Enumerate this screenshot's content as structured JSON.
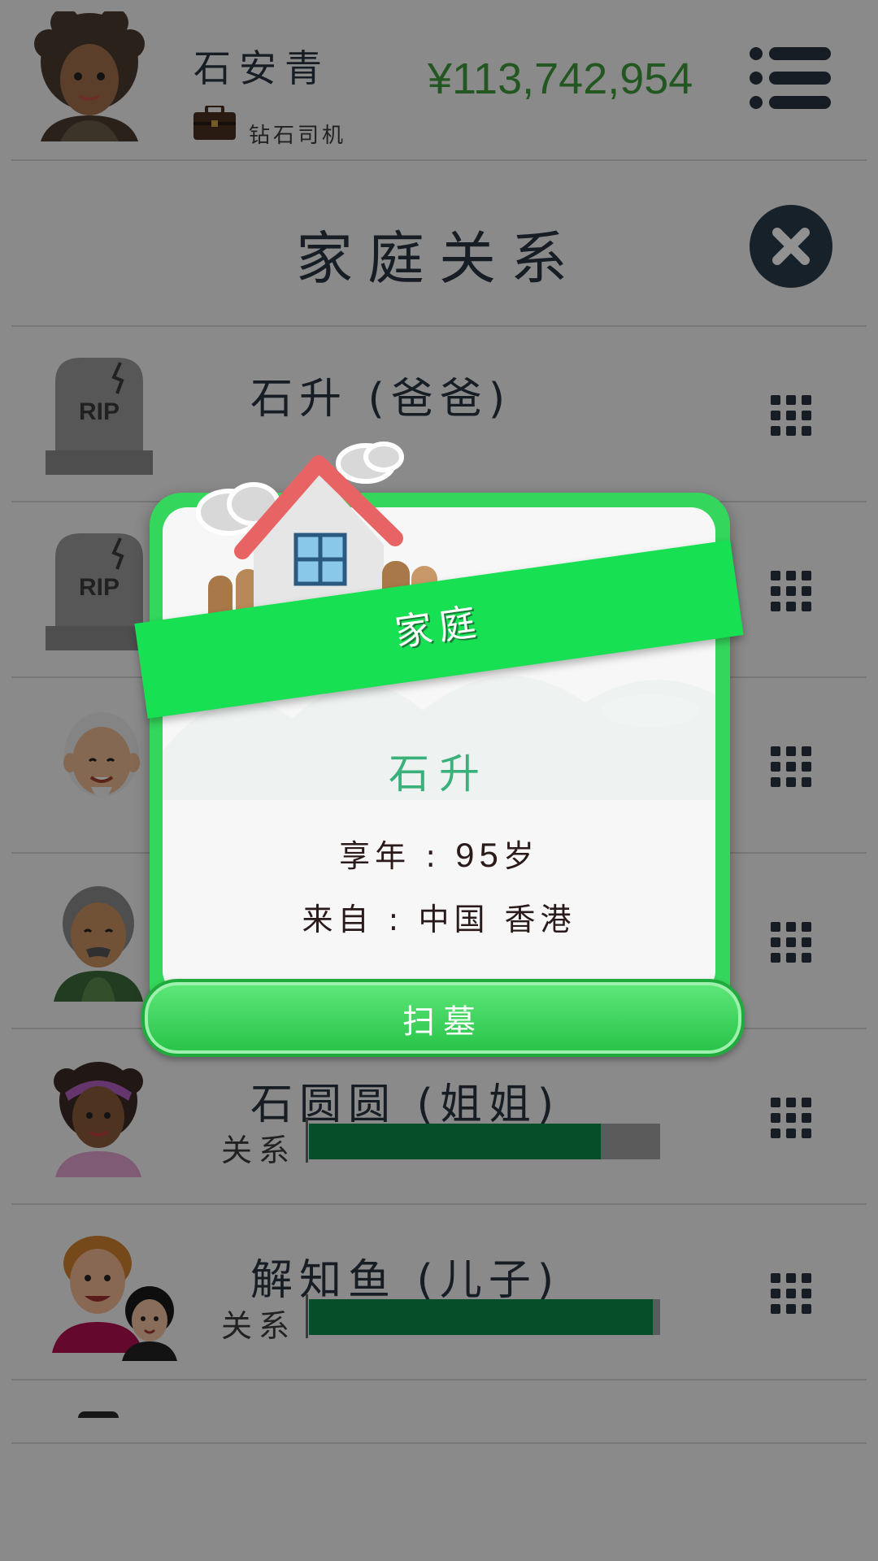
{
  "header": {
    "player_name": "石安青",
    "job_title": "钻石司机",
    "money": "¥113,742,954"
  },
  "dialog": {
    "title": "家庭关系"
  },
  "family": [
    {
      "name": "石升 (爸爸)",
      "avatar": "tombstone-icon",
      "status": "deceased"
    },
    {
      "name": "",
      "avatar": "tombstone-icon",
      "status": "deceased"
    },
    {
      "name": "",
      "avatar": "elderly-man-avatar"
    },
    {
      "name": "",
      "avatar": "grandpa-avatar"
    },
    {
      "name": "石圆圆 (姐姐)",
      "avatar": "sister-avatar",
      "relation_label": "关系",
      "relation": 0.83
    },
    {
      "name": "解知鱼 (儿子)",
      "avatar": "son-avatar",
      "relation_label": "关系",
      "relation": 0.98
    }
  ],
  "modal": {
    "banner": "家庭",
    "person_name": "石升",
    "age_label": "享年",
    "age_value": "95",
    "age_unit": "岁",
    "origin_label": "来自",
    "origin_value": "中国 香港",
    "action_button": "扫墓"
  },
  "tombstone_text": "RIP",
  "colors": {
    "money": "#3f9a3a",
    "banner": "#17e052",
    "relation_bar": "#0c8a4a",
    "modal_frame": "#34d65c",
    "modal_name": "#3ab07a"
  }
}
